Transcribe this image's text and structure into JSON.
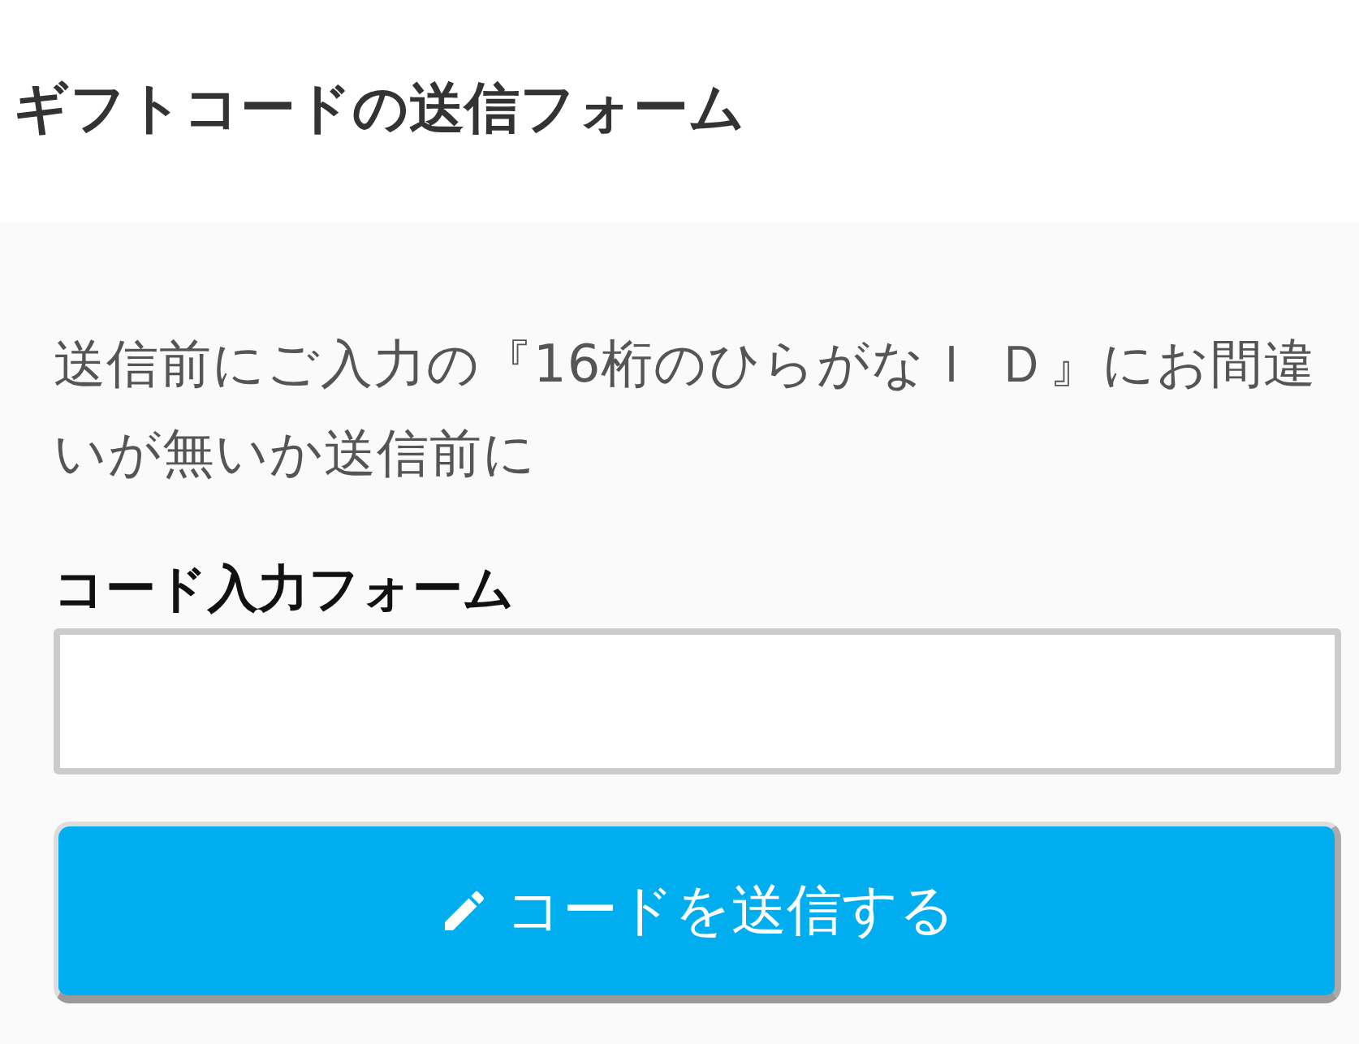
{
  "header": {
    "title": "ギフトコードの送信フォーム"
  },
  "form": {
    "notice": "送信前にご入力の『16桁のひらがなＩ Ｄ』にお間違いが無いか送信前に",
    "label": "コード入力フォーム",
    "submit": {
      "label": "コードを送信する"
    }
  }
}
